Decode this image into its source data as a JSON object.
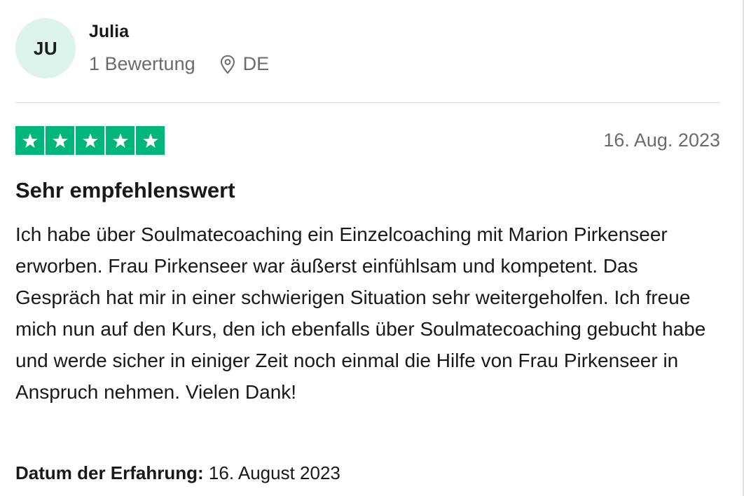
{
  "reviewer": {
    "initials": "JU",
    "name": "Julia",
    "review_count": "1 Bewertung",
    "country": "DE",
    "avatar_color": "#dcf4ea"
  },
  "review": {
    "rating": 5,
    "max_rating": 5,
    "star_color": "#00b67a",
    "date": "16. Aug. 2023",
    "title": "Sehr empfehlenswert",
    "body": "Ich habe über Soulmatecoaching ein Einzelcoaching mit Marion Pirkenseer erworben. Frau Pirkenseer war äußerst einfühlsam und kompetent. Das Gespräch hat mir in einer schwierigen Situation sehr weitergeholfen. Ich freue mich nun auf den Kurs, den ich ebenfalls über Soulmatecoaching gebucht habe und werde sicher in einiger Zeit noch einmal die Hilfe von Frau Pirkenseer in Anspruch nehmen. Vielen Dank!",
    "experience_label": "Datum der Erfahrung:",
    "experience_date": "16. August 2023"
  },
  "icons": {
    "location": "location-pin-icon",
    "star": "star-icon"
  }
}
